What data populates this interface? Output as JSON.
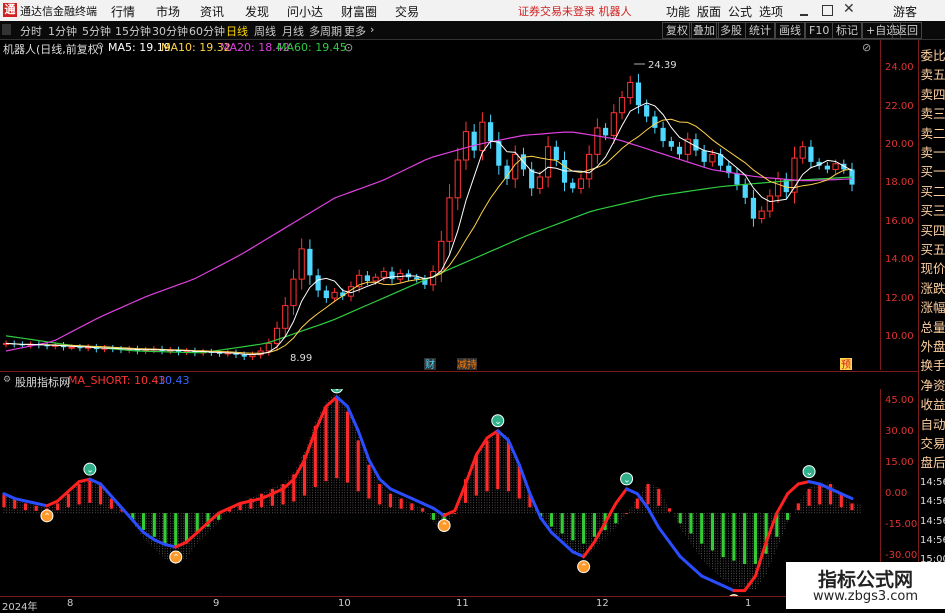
{
  "app": {
    "title": "通达信金融终端",
    "logo_char": "通"
  },
  "menu": [
    "行情",
    "市场",
    "资讯",
    "发现",
    "问小达",
    "财富圈",
    "交易"
  ],
  "login_warning": "证券交易未登录  机器人",
  "right_menu": [
    "功能",
    "版面",
    "公式",
    "选项",
    "游客"
  ],
  "timeframes": [
    "分时",
    "1分钟",
    "5分钟",
    "15分钟",
    "30分钟",
    "60分钟",
    "日线",
    "周线",
    "月线",
    "多周期",
    "更多"
  ],
  "active_timeframe": "日线",
  "toolbar_right": [
    "复权",
    "叠加",
    "多股",
    "统计",
    "画线",
    "F10",
    "标记",
    "+自选",
    "返回"
  ],
  "stock_info": {
    "name": "机器人(日线,前复权)",
    "ma5": "MA5: 19.19",
    "ma10": "MA10: 19.32",
    "ma20": "MA20: 18.42",
    "ma60": "MA60: 19.45"
  },
  "side_panel": [
    "委比",
    "卖五",
    "卖四",
    "卖三",
    "卖二",
    "卖一",
    "买一",
    "买二",
    "买三",
    "买四",
    "买五",
    "现价",
    "涨跌",
    "涨幅",
    "总量",
    "外盘",
    "换手",
    "净资",
    "收益",
    "自动",
    "交易",
    "盘后",
    "14:56",
    "14:56",
    "14:56",
    "14:56",
    "15:00",
    "15:00",
    "15:00"
  ],
  "price_ticks": [
    "24.00",
    "22.00",
    "20.00",
    "18.00",
    "16.00",
    "14.00",
    "12.00",
    "10.00"
  ],
  "high_label": "24.39",
  "low_label": "8.99",
  "event_markers": [
    {
      "text": "财"
    },
    {
      "text": "减持"
    },
    {
      "text": "预"
    }
  ],
  "indicator": {
    "name": "股朋指标网",
    "line_label": "MA_SHORT: 10.43",
    "value": "10.43"
  },
  "ind_ticks": [
    "45.00",
    "30.00",
    "15.00",
    "0.00",
    "-15.00",
    "-30.00"
  ],
  "x_labels": [
    "2024年",
    "8",
    "9",
    "10",
    "11",
    "12",
    "1"
  ],
  "watermark": {
    "line1": "指标公式网",
    "line2": "www.zbgs3.com"
  },
  "colors": {
    "up": "#ff3333",
    "down": "#4fd7ff",
    "ma5": "#ffffff",
    "ma10": "#ffd24a",
    "ma20": "#e040e0",
    "ma60": "#2ecc40",
    "accent": "#d21f1f"
  },
  "chart_data": {
    "type": "candlestick",
    "title": "机器人(日线,前复权)",
    "ylim": [
      8.5,
      25
    ],
    "closes": [
      9.8,
      9.75,
      9.7,
      9.75,
      9.7,
      9.65,
      9.7,
      9.6,
      9.6,
      9.55,
      9.6,
      9.5,
      9.55,
      9.5,
      9.45,
      9.5,
      9.4,
      9.45,
      9.5,
      9.4,
      9.45,
      9.35,
      9.4,
      9.3,
      9.35,
      9.3,
      9.25,
      9.3,
      9.2,
      9.1,
      9.2,
      9.4,
      9.8,
      10.6,
      11.8,
      13.2,
      14.8,
      13.4,
      12.6,
      12.2,
      12.5,
      12.3,
      12.8,
      13.4,
      13.1,
      13.3,
      13.6,
      13.2,
      13.5,
      13.3,
      13.2,
      12.9,
      13.6,
      15.2,
      17.5,
      19.5,
      21.0,
      20.0,
      21.5,
      20.5,
      19.2,
      18.5,
      19.8,
      19.0,
      18.0,
      18.6,
      20.2,
      19.5,
      18.3,
      18.0,
      18.5,
      19.8,
      21.2,
      20.8,
      22.0,
      22.8,
      23.6,
      22.4,
      21.8,
      21.2,
      20.5,
      20.2,
      19.8,
      20.6,
      20.0,
      19.4,
      19.8,
      19.2,
      18.8,
      18.2,
      17.5,
      16.4,
      16.8,
      17.6,
      18.5,
      17.8,
      19.6,
      20.2,
      19.4,
      19.2,
      19.0,
      19.3,
      19.0,
      18.2
    ],
    "ma20_values": [
      9.4,
      9.9,
      11.2,
      12.3,
      13.2,
      14.5,
      16.0,
      17.5,
      18.4,
      19.6,
      20.3,
      20.8,
      21.0,
      20.6,
      19.8,
      19.0,
      18.6,
      18.4,
      18.5
    ],
    "ma60_values": [
      10.2,
      9.7,
      9.4,
      9.3,
      9.8,
      11.0,
      12.5,
      14.0,
      15.5,
      16.8,
      17.6,
      18.1,
      18.4,
      18.6
    ]
  },
  "indicator_data": {
    "bar_values": [
      8,
      6,
      4,
      3,
      2,
      4,
      8,
      12,
      14,
      12,
      6,
      2,
      -4,
      -10,
      -14,
      -18,
      -20,
      -18,
      -12,
      -8,
      -4,
      2,
      4,
      6,
      8,
      10,
      12,
      16,
      24,
      36,
      44,
      48,
      42,
      30,
      20,
      12,
      8,
      6,
      4,
      2,
      -4,
      -8,
      0,
      14,
      24,
      30,
      33,
      30,
      20,
      8,
      -2,
      -8,
      -12,
      -16,
      -18,
      -14,
      -10,
      -6,
      0,
      6,
      12,
      10,
      2,
      -6,
      -12,
      -18,
      -22,
      -26,
      -28,
      -30,
      -30,
      -24,
      -14,
      -4,
      4,
      10,
      12,
      12,
      8,
      4
    ],
    "line_values": [
      8,
      6,
      5,
      4,
      3,
      5,
      9,
      13,
      14,
      12,
      7,
      2,
      -3,
      -8,
      -11,
      -13,
      -14,
      -12,
      -8,
      -4,
      0,
      2,
      4,
      5,
      6,
      8,
      10,
      14,
      22,
      34,
      44,
      48,
      44,
      34,
      22,
      14,
      10,
      8,
      6,
      4,
      2,
      -1,
      1,
      12,
      24,
      31,
      34,
      30,
      20,
      8,
      -2,
      -8,
      -12,
      -16,
      -18,
      -12,
      -4,
      4,
      10,
      8,
      2,
      -6,
      -12,
      -18,
      -22,
      -26,
      -28,
      -30,
      -32,
      -32,
      -26,
      -12,
      0,
      8,
      12,
      13,
      12,
      10,
      8,
      6
    ],
    "ylim": [
      -33,
      50
    ]
  }
}
